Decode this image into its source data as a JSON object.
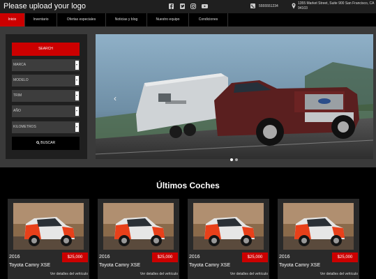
{
  "header": {
    "logo_text": "Please upload your logo",
    "phone": "5555551234",
    "address": "1355 Market Street, Suite 900 San Francisco, CA 94103",
    "social_icons": [
      "facebook-icon",
      "twitter-icon",
      "instagram-icon",
      "youtube-icon"
    ]
  },
  "nav": {
    "items": [
      {
        "label": "Inicio"
      },
      {
        "label": "Inventario"
      },
      {
        "label": "Ofertas especiales"
      },
      {
        "label": "Noticias y blog"
      },
      {
        "label": "Nuestro equipo"
      },
      {
        "label": "Condiciones"
      }
    ]
  },
  "search": {
    "title_button": "SEARCH",
    "fields": [
      {
        "label": "MARCA"
      },
      {
        "label": "MODELO"
      },
      {
        "label": "TRIM"
      },
      {
        "label": "AÑO"
      },
      {
        "label": "KILOMETROS"
      }
    ],
    "submit_label": "BUSCAR"
  },
  "slider": {
    "prev_symbol": "‹",
    "active_slide": 1,
    "slide_count": 2
  },
  "latest": {
    "title": "Últimos Coches",
    "cards": [
      {
        "year": "2016",
        "price": "$25,000",
        "name": "Toyota Camry XSE",
        "details": "Ver detalles del vehículo"
      },
      {
        "year": "2016",
        "price": "$25,000",
        "name": "Toyota Camry XSE",
        "details": "Ver detalles del vehículo"
      },
      {
        "year": "2016",
        "price": "$25,000",
        "name": "Toyota Camry XSE",
        "details": "Ver detalles del vehículo"
      },
      {
        "year": "2016",
        "price": "$25,000",
        "name": "Toyota Camry XSE",
        "details": "Ver detalles del vehículo"
      }
    ]
  },
  "colors": {
    "accent": "#cc0000",
    "topbar": "#1f1f1f",
    "panel": "#1f1f1f",
    "hero_bg": "#3a3a3a",
    "page_bg": "#000000"
  }
}
